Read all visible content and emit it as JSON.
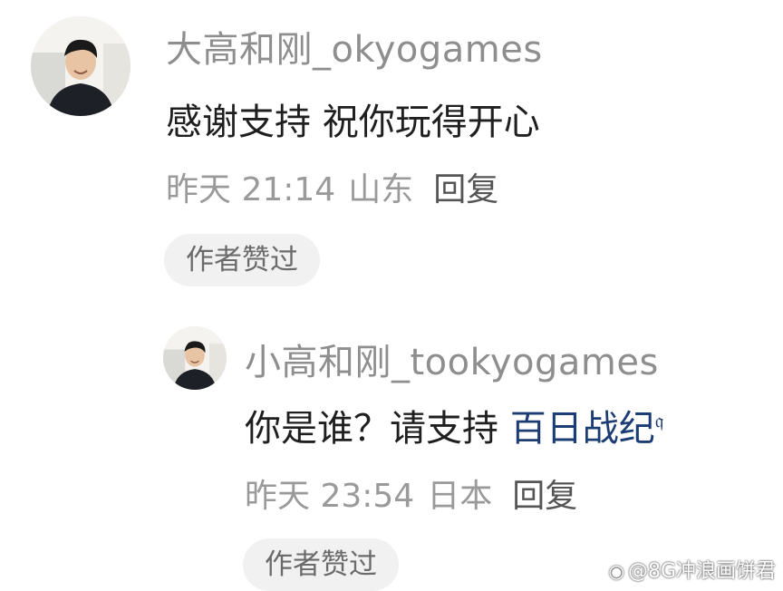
{
  "comments": [
    {
      "username": "大高和刚_okyogames",
      "text": "感谢支持 祝你玩得开心",
      "time": "昨天 21:14",
      "location": "山东",
      "reply_label": "回复",
      "badge": "作者赞过"
    },
    {
      "username": "小高和刚_tookyogames",
      "text_prefix": "你是谁？请支持",
      "link_text": "百日战纪",
      "time": "昨天 23:54",
      "location": "日本",
      "reply_label": "回复",
      "badge": "作者赞过"
    }
  ],
  "watermark": "@8G冲浪画饼君",
  "colors": {
    "link": "#1b3d73",
    "meta": "#9a9a9a",
    "badge_bg": "#f1f1f1"
  }
}
